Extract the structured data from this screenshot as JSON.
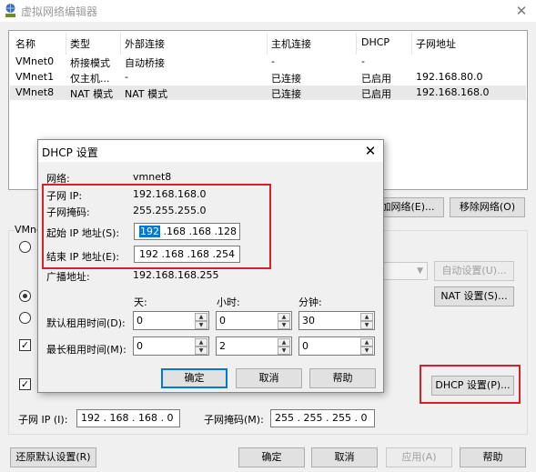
{
  "window": {
    "title": "虚拟网络编辑器",
    "close_glyph": "✕"
  },
  "network_list": {
    "columns": [
      "名称",
      "类型",
      "外部连接",
      "主机连接",
      "DHCP",
      "子网地址"
    ],
    "rows": [
      {
        "name": "VMnet0",
        "type": "桥接模式",
        "external": "自动桥接",
        "host": "-",
        "dhcp": "-",
        "subnet": ""
      },
      {
        "name": "VMnet1",
        "type": "仅主机...",
        "external": "-",
        "host": "已连接",
        "dhcp": "已启用",
        "subnet": "192.168.80.0"
      },
      {
        "name": "VMnet8",
        "type": "NAT 模式",
        "external": "NAT 模式",
        "host": "已连接",
        "dhcp": "已启用",
        "subnet": "192.168.168.0"
      }
    ]
  },
  "list_buttons": {
    "add": "加网络(E)...",
    "remove": "移除网络(O)"
  },
  "vmnet_info_label": "VMne",
  "right_buttons": {
    "auto_settings": "自动设置(U)...",
    "nat_settings": "NAT 设置(S)...",
    "dhcp_settings": "DHCP 设置(P)..."
  },
  "subnet_row": {
    "ip_label": "子网 IP (I):",
    "ip_value": "192 . 168 . 168 . 0",
    "mask_label": "子网掩码(M):",
    "mask_value": "255 . 255 . 255 . 0"
  },
  "bottom_buttons": {
    "restore": "还原默认设置(R)",
    "ok": "确定",
    "cancel": "取消",
    "apply": "应用(A)",
    "help": "帮助"
  },
  "dhcp_dialog": {
    "title": "DHCP 设置",
    "close_glyph": "✕",
    "network_label": "网络:",
    "network_value": "vmnet8",
    "subnet_ip_label": "子网 IP:",
    "subnet_ip_value": "192.168.168.0",
    "subnet_mask_label": "子网掩码:",
    "subnet_mask_value": "255.255.255.0",
    "start_ip_label": "起始 IP 地址(S):",
    "start_ip_first": "192",
    "start_ip_rest": ".168 .168 .128",
    "end_ip_label": "结束 IP 地址(E):",
    "end_ip_value": "192 .168 .168 .254",
    "broadcast_label": "广播地址:",
    "broadcast_value": "192.168.168.255",
    "col_days": "天:",
    "col_hours": "小时:",
    "col_minutes": "分钟:",
    "default_lease_label": "默认租用时间(D):",
    "default_lease": {
      "days": "0",
      "hours": "0",
      "minutes": "30"
    },
    "max_lease_label": "最长租用时间(M):",
    "max_lease": {
      "days": "0",
      "hours": "2",
      "minutes": "0"
    },
    "ok": "确定",
    "cancel": "取消",
    "help": "帮助"
  },
  "colors": {
    "highlight_box": "#d8202a",
    "selection": "#0078d7"
  }
}
